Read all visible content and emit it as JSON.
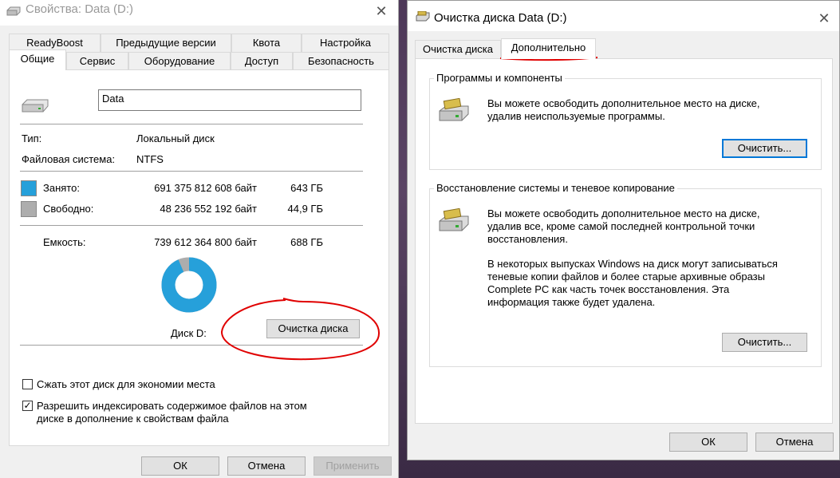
{
  "props_window": {
    "title": "Свойства: Data (D:)",
    "tabs_row1": [
      "ReadyBoost",
      "Предыдущие версии",
      "Квота",
      "Настройка"
    ],
    "tabs_row2": [
      "Общие",
      "Сервис",
      "Оборудование",
      "Доступ",
      "Безопасность"
    ],
    "active_tab": "Общие",
    "volume_label": "Data",
    "type_label": "Тип:",
    "type_value": "Локальный диск",
    "fs_label": "Файловая система:",
    "fs_value": "NTFS",
    "used_label": "Занято:",
    "used_bytes": "691 375 812 608 байт",
    "used_gb": "643 ГБ",
    "free_label": "Свободно:",
    "free_bytes": "48 236 552 192 байт",
    "free_gb": "44,9 ГБ",
    "capacity_label": "Емкость:",
    "capacity_bytes": "739 612 364 800 байт",
    "capacity_gb": "688 ГБ",
    "used_fraction": 0.935,
    "disk_label": "Диск D:",
    "cleanup_button": "Очистка диска",
    "compress_checkbox": "Сжать этот диск для экономии места",
    "compress_checked": false,
    "index_checkbox_line1": "Разрешить индексировать содержимое файлов на этом",
    "index_checkbox_line2": "диске в дополнение к свойствам файла",
    "index_checked": true,
    "ok": "ОК",
    "cancel": "Отмена",
    "apply": "Применить",
    "colors": {
      "used": "#26a0da",
      "free": "#adadad",
      "annotation": "#e00000"
    }
  },
  "cleanup_window": {
    "title": "Очистка диска Data (D:)",
    "tabs": [
      "Очистка диска",
      "Дополнительно"
    ],
    "active_tab": "Дополнительно",
    "group1_title": "Программы и компоненты",
    "group1_text1": "Вы можете освободить дополнительное место на диске,",
    "group1_text2": "удалив неиспользуемые программы.",
    "group1_button": "Очистить...",
    "group2_title": "Восстановление системы и теневое копирование",
    "group2_p1_line1": "Вы можете освободить дополнительное место на диске,",
    "group2_p1_line2": "удалив все, кроме самой последней контрольной точки",
    "group2_p1_line3": "восстановления.",
    "group2_p2_line1": "В некоторых выпусках Windows на диск могут записываться",
    "group2_p2_line2": "теневые копии файлов и более старые архивные образы",
    "group2_p2_line3": "Complete PC как часть точек восстановления. Эта",
    "group2_p2_line4": "информация также будет удалена.",
    "group2_button": "Очистить...",
    "ok": "ОК",
    "cancel": "Отмена"
  }
}
